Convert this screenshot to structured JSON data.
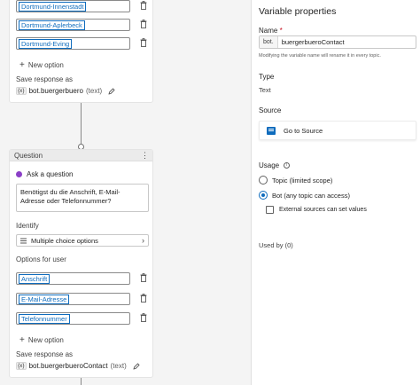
{
  "canvas": {
    "card1": {
      "options": [
        "Dortmund-Innenstadt",
        "Dortmund-Aplerbeck",
        "Dortmund-Eving"
      ],
      "new_option_label": "New option",
      "save_response_label": "Save response as",
      "variable_icon": "{x}",
      "variable_name": "bot.buergerbuero",
      "variable_type": "(text)"
    },
    "card2": {
      "header_title": "Question",
      "menu_glyph": "⋮",
      "ask_label": "Ask a question",
      "question_text": "Benötigst du die Anschrift, E-Mail-Adresse oder Telefonnummer?",
      "identify_label": "Identify",
      "identify_value": "Multiple choice options",
      "chevron_glyph": "›",
      "options_label": "Options for user",
      "options": [
        "Anschrift",
        "E-Mail-Adresse",
        "Telefonnummer"
      ],
      "new_option_label": "New option",
      "save_response_label": "Save response as",
      "variable_icon": "{x}",
      "variable_name": "bot.buergerbueroContact",
      "variable_type": "(text)"
    }
  },
  "panel": {
    "title": "Variable properties",
    "name_label": "Name",
    "required_mark": "*",
    "name_prefix": "bot.",
    "name_value": "buergerbueroContact",
    "name_hint": "Modifying the variable name will rename it in every topic.",
    "type_label": "Type",
    "type_value": "Text",
    "source_label": "Source",
    "source_link": "Go to Source",
    "usage_label": "Usage",
    "info_glyph": "i",
    "radio_topic": "Topic (limited scope)",
    "radio_bot": "Bot (any topic can access)",
    "external_checkbox": "External sources can set values",
    "used_by": "Used by (0)"
  },
  "colors": {
    "accent": "#0f6cbd",
    "question_icon": "#8b3fc7",
    "required": "#c50f1f"
  },
  "icons": [
    "trash-icon",
    "plus-icon",
    "variable-icon",
    "pencil-icon",
    "more-icon",
    "ask-question-icon",
    "multiple-choice-icon",
    "chevron-right-icon",
    "source-icon",
    "info-icon"
  ]
}
